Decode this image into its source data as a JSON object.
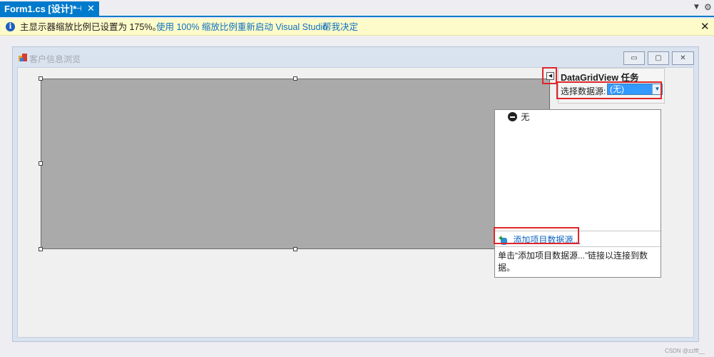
{
  "tab": {
    "title": "Form1.cs [设计]*",
    "pin_icon": "pin-icon",
    "close_icon": "close-icon"
  },
  "strip": {
    "dropdown_icon": "chevron-down-icon",
    "gear_icon": "gear-icon"
  },
  "infobar": {
    "message": "主显示器缩放比例已设置为 175%。",
    "link_restart": "使用 100% 缩放比例重新启动 Visual Studio",
    "link_help": "帮我决定",
    "close": "✕"
  },
  "form": {
    "title": "客户信息浏览",
    "min": "▭",
    "max": "▢",
    "close": "✕"
  },
  "tasks": {
    "title": "DataGridView 任务",
    "datasource_label": "选择数据源:",
    "datasource_value": "(无)"
  },
  "dropdown": {
    "item_none": "无",
    "add_datasource": "添加项目数据源...",
    "help_text": "单击“添加项目数据源...”链接以连接到数据。"
  },
  "watermark": "CSDN @zzfff__"
}
